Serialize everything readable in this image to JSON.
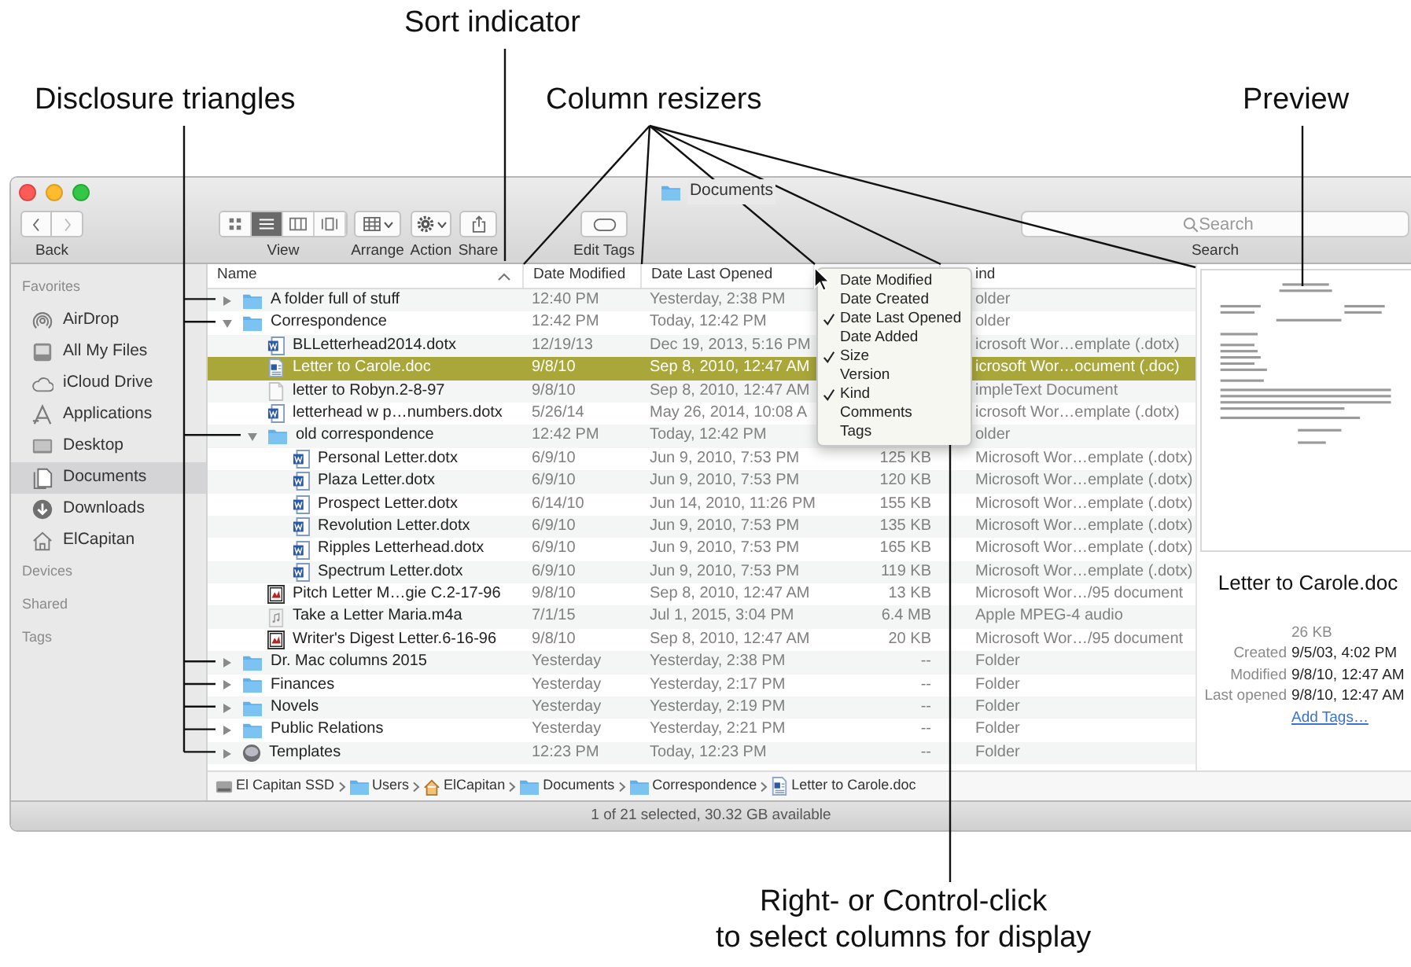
{
  "callouts": [
    {
      "text": "Sort indicator"
    },
    {
      "text": "Disclosure triangles"
    },
    {
      "text": "Column resizers"
    },
    {
      "text": "Preview"
    },
    {
      "text": "Right- or Control-click\nto select columns for display"
    }
  ],
  "window": {
    "title": "Documents"
  },
  "toolbar": {
    "back_label": "Back",
    "view_label": "View",
    "arrange_label": "Arrange",
    "action_label": "Action",
    "share_label": "Share",
    "tags_label": "Edit Tags",
    "search_placeholder": "Search",
    "search_label": "Search",
    "view_modes": [
      {
        "kind": "icons",
        "selected": false
      },
      {
        "kind": "list",
        "selected": true
      },
      {
        "kind": "columns",
        "selected": false
      },
      {
        "kind": "cover_flow",
        "selected": false
      }
    ]
  },
  "sidebar": [
    {
      "title": "Favorites",
      "items": [
        {
          "label": "AirDrop",
          "kind": "airdrop",
          "selected": false
        },
        {
          "label": "All My Files",
          "kind": "all_files",
          "selected": false
        },
        {
          "label": "iCloud Drive",
          "kind": "cloud",
          "selected": false
        },
        {
          "label": "Applications",
          "kind": "applications",
          "selected": false
        },
        {
          "label": "Desktop",
          "kind": "desktop",
          "selected": false
        },
        {
          "label": "Documents",
          "kind": "documents",
          "selected": true
        },
        {
          "label": "Downloads",
          "kind": "downloads",
          "selected": false
        },
        {
          "label": "ElCapitan",
          "kind": "home",
          "selected": false
        }
      ]
    },
    {
      "title": "Devices"
    },
    {
      "title": "Shared"
    },
    {
      "title": "Tags"
    }
  ],
  "table": {
    "header": {
      "name": "Name",
      "name_sort_ascending": true,
      "date_modified": "Date Modified",
      "date_last_opened": "Date Last Opened",
      "kind": "ind"
    },
    "rows": [
      {
        "name": "A folder full of stuff",
        "kind": "folder",
        "expanded": false,
        "selected": false,
        "date_modified": "12:40 PM",
        "date_last_opened": "Yesterday, 2:38 PM",
        "kind_text": "older"
      },
      {
        "name": "Correspondence",
        "kind": "folder",
        "expanded": true,
        "selected": false,
        "date_modified": "12:42 PM",
        "date_last_opened": "Today, 12:42 PM",
        "kind_text": "older",
        "children": [
          {
            "name": "BLLetterhead2014.dotx",
            "kind": "word",
            "selected": false,
            "date_modified": "12/19/13",
            "date_last_opened": "Dec 19, 2013, 5:16 PM",
            "kind_text": "icrosoft Wor…emplate (.dotx)"
          },
          {
            "name": "Letter to Carole.doc",
            "kind": "doc",
            "selected": true,
            "date_modified": "9/8/10",
            "date_last_opened": "Sep 8, 2010, 12:47 AM",
            "kind_text": "icrosoft Wor…ocument (.doc)"
          },
          {
            "name": "letter to Robyn.2-8-97",
            "kind": "text",
            "selected": false,
            "date_modified": "9/8/10",
            "date_last_opened": "Sep 8, 2010, 12:47 AM",
            "kind_text": "impleText Document"
          },
          {
            "name": "letterhead w p…numbers.dotx",
            "kind": "word",
            "selected": false,
            "date_modified": "5/26/14",
            "date_last_opened": "May 26, 2014, 10:08 A",
            "kind_text": "icrosoft Wor…emplate (.dotx)"
          },
          {
            "name": "old correspondence",
            "kind": "folder",
            "expanded": true,
            "selected": false,
            "date_modified": "12:42 PM",
            "date_last_opened": "Today, 12:42 PM",
            "kind_text": "older",
            "children": [
              {
                "name": "Personal Letter.dotx",
                "kind": "word",
                "selected": false,
                "date_modified": "6/9/10",
                "date_last_opened": "Jun 9, 2010, 7:53 PM",
                "size": "125 KB",
                "kind_text": "Microsoft Wor…emplate (.dotx)"
              },
              {
                "name": "Plaza Letter.dotx",
                "kind": "word",
                "selected": false,
                "date_modified": "6/9/10",
                "date_last_opened": "Jun 9, 2010, 7:53 PM",
                "size": "120 KB",
                "kind_text": "Microsoft Wor…emplate (.dotx)"
              },
              {
                "name": "Prospect Letter.dotx",
                "kind": "word",
                "selected": false,
                "date_modified": "6/14/10",
                "date_last_opened": "Jun 14, 2010, 11:26 PM",
                "size": "155 KB",
                "kind_text": "Microsoft Wor…emplate (.dotx)"
              },
              {
                "name": "Revolution Letter.dotx",
                "kind": "word",
                "selected": false,
                "date_modified": "6/9/10",
                "date_last_opened": "Jun 9, 2010, 7:53 PM",
                "size": "135 KB",
                "kind_text": "Microsoft Wor…emplate (.dotx)"
              },
              {
                "name": "Ripples Letterhead.dotx",
                "kind": "word",
                "selected": false,
                "date_modified": "6/9/10",
                "date_last_opened": "Jun 9, 2010, 7:53 PM",
                "size": "165 KB",
                "kind_text": "Microsoft Wor…emplate (.dotx)"
              },
              {
                "name": "Spectrum Letter.dotx",
                "kind": "word",
                "selected": false,
                "date_modified": "6/9/10",
                "date_last_opened": "Jun 9, 2010, 7:53 PM",
                "size": "119 KB",
                "kind_text": "Microsoft Wor…emplate (.dotx)"
              }
            ]
          },
          {
            "name": "Pitch Letter M…gie C.2-17-96",
            "kind": "image",
            "selected": false,
            "date_modified": "9/8/10",
            "date_last_opened": "Sep 8, 2010, 12:47 AM",
            "size": "13 KB",
            "kind_text": "Microsoft Wor…/95 document"
          },
          {
            "name": "Take a Letter Maria.m4a",
            "kind": "audio",
            "selected": false,
            "date_modified": "7/1/15",
            "date_last_opened": "Jul 1, 2015, 3:04 PM",
            "size": "6.4 MB",
            "kind_text": "Apple MPEG-4 audio"
          },
          {
            "name": "Writer's Digest Letter.6-16-96",
            "kind": "image",
            "selected": false,
            "date_modified": "9/8/10",
            "date_last_opened": "Sep 8, 2010, 12:47 AM",
            "size": "20 KB",
            "kind_text": "Microsoft Wor…/95 document"
          }
        ]
      },
      {
        "name": "Dr. Mac columns 2015",
        "kind": "folder",
        "expanded": false,
        "selected": false,
        "date_modified": "Yesterday",
        "date_last_opened": "Yesterday, 2:38 PM",
        "size": "--",
        "kind_text": "Folder"
      },
      {
        "name": "Finances",
        "kind": "folder",
        "expanded": false,
        "selected": false,
        "date_modified": "Yesterday",
        "date_last_opened": "Yesterday, 2:17 PM",
        "size": "--",
        "kind_text": "Folder"
      },
      {
        "name": "Novels",
        "kind": "folder",
        "expanded": false,
        "selected": false,
        "date_modified": "Yesterday",
        "date_last_opened": "Yesterday, 2:19 PM",
        "size": "--",
        "kind_text": "Folder"
      },
      {
        "name": "Public Relations",
        "kind": "folder",
        "expanded": false,
        "selected": false,
        "date_modified": "Yesterday",
        "date_last_opened": "Yesterday, 2:21 PM",
        "size": "--",
        "kind_text": "Folder"
      },
      {
        "name": "Templates",
        "kind": "disc",
        "expanded": false,
        "selected": false,
        "date_modified": "12:23 PM",
        "date_last_opened": "Today, 12:23 PM",
        "size": "--",
        "kind_text": "Folder"
      }
    ]
  },
  "column_menu": [
    {
      "label": "Date Modified",
      "checked": false
    },
    {
      "label": "Date Created",
      "checked": false
    },
    {
      "label": "Date Last Opened",
      "checked": true
    },
    {
      "label": "Date Added",
      "checked": false
    },
    {
      "label": "Size",
      "checked": true
    },
    {
      "label": "Version",
      "checked": false
    },
    {
      "label": "Kind",
      "checked": true
    },
    {
      "label": "Comments",
      "checked": false
    },
    {
      "label": "Tags",
      "checked": false
    }
  ],
  "preview": {
    "filename": "Letter to Carole.doc",
    "size": "26 KB",
    "details": [
      {
        "label": "Created",
        "value": "9/5/03, 4:02 PM"
      },
      {
        "label": "Modified",
        "value": "9/8/10, 12:47 AM"
      },
      {
        "label": "Last opened",
        "value": "9/8/10, 12:47 AM"
      }
    ],
    "add_tags": "Add Tags…"
  },
  "path_bar": [
    {
      "label": "El Capitan SSD",
      "kind": "disk"
    },
    {
      "label": "Users",
      "kind": "users"
    },
    {
      "label": "ElCapitan",
      "kind": "home"
    },
    {
      "label": "Documents",
      "kind": "documents"
    },
    {
      "label": "Correspondence",
      "kind": "folder"
    },
    {
      "label": "Letter to Carole.doc",
      "kind": "doc"
    }
  ],
  "status_bar": "1 of 21 selected, 30.32 GB available"
}
